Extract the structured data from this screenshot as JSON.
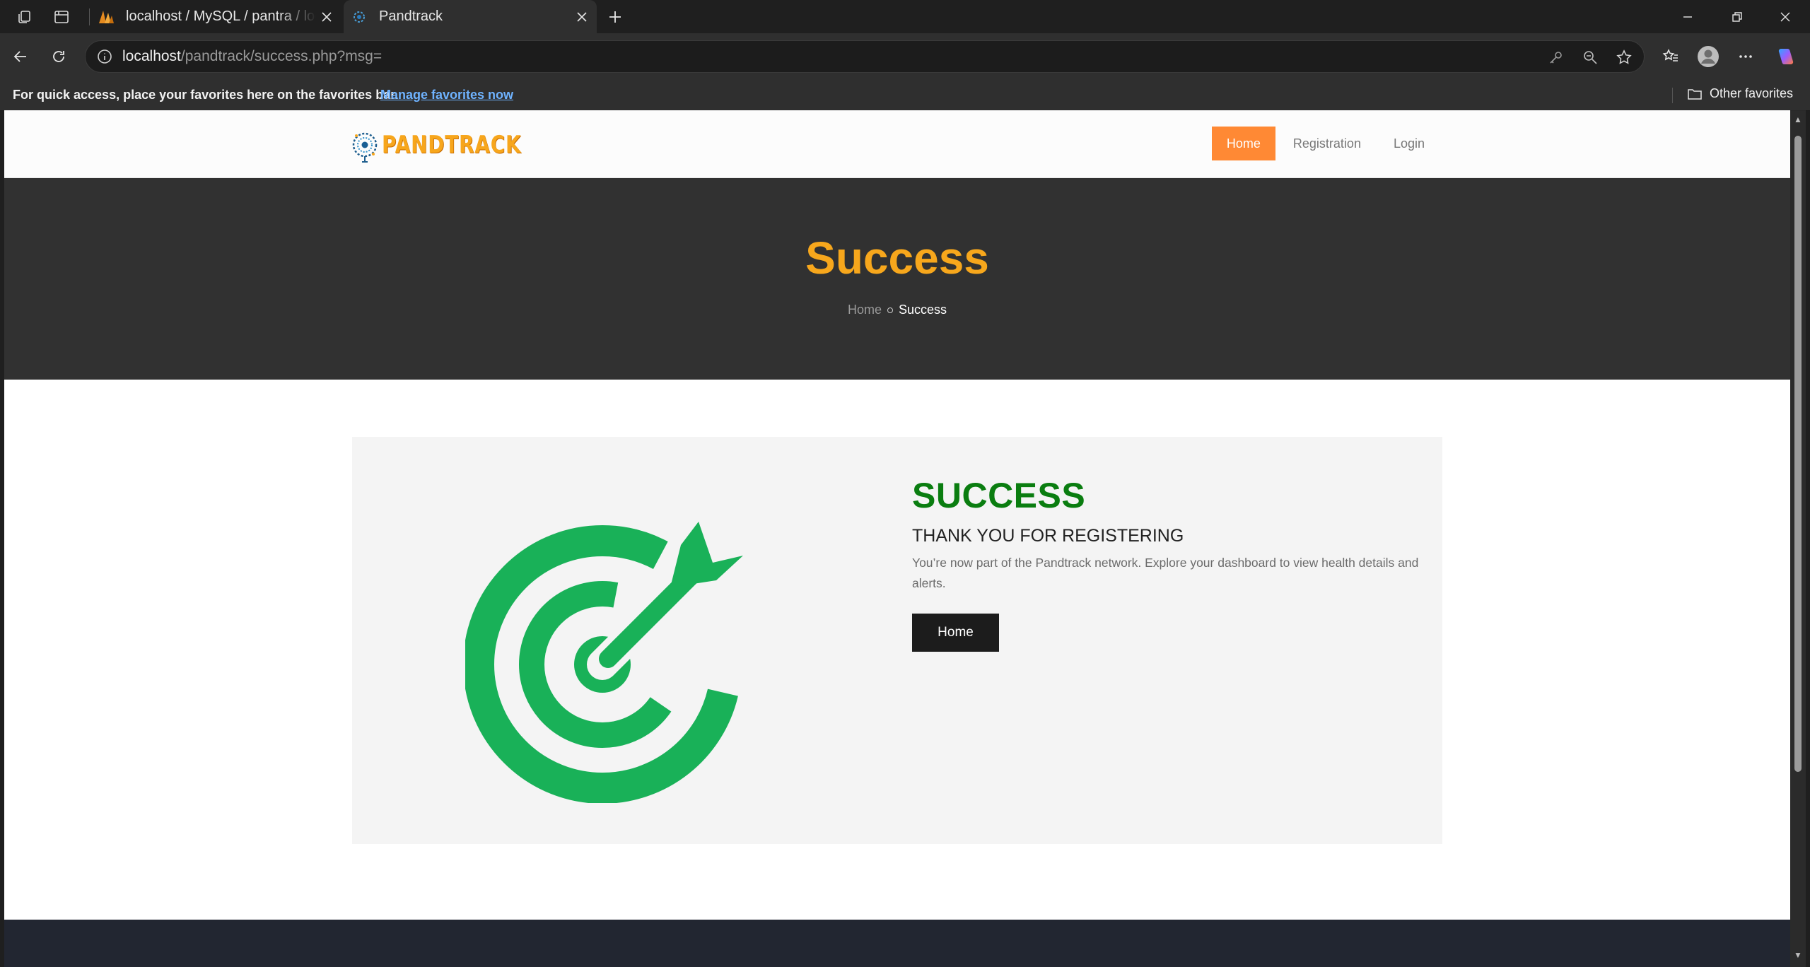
{
  "browser": {
    "tabs": [
      {
        "title": "localhost / MySQL / pantra / login",
        "active": false
      },
      {
        "title": "Pandtrack",
        "active": true
      }
    ],
    "address": {
      "host": "localhost",
      "path": "/pandtrack/success.php?msg="
    },
    "favorites_bar": {
      "message": "For quick access, place your favorites here on the favorites bar.",
      "link": "Manage favorites now",
      "other": "Other favorites"
    }
  },
  "site": {
    "logo_text": "PANDTRACK",
    "nav": [
      "Home",
      "Registration",
      "Login"
    ],
    "active_nav": "Home"
  },
  "hero": {
    "title": "Success",
    "breadcrumb": {
      "home": "Home",
      "current": "Success"
    }
  },
  "card": {
    "heading": "SUCCESS",
    "subheading": "THANK YOU FOR REGISTERING",
    "body": "You’re now part of the Pandtrack network. Explore your dashboard to view health details and alerts.",
    "button": "Home"
  },
  "colors": {
    "accent_orange": "#ff8934",
    "hero_title": "#f7a71c",
    "success_green": "#0a7d10",
    "target_green": "#19b158",
    "hero_bg": "#313131",
    "footer_bg": "#222631"
  },
  "icons": [
    "workspaces-icon",
    "tab-actions-icon",
    "phpmyadmin-favicon",
    "pandtrack-favicon",
    "close-icon",
    "plus-icon",
    "minimize-icon",
    "restore-icon",
    "back-icon",
    "refresh-icon",
    "info-icon",
    "key-icon",
    "zoom-out-icon",
    "star-icon",
    "favorites-icon",
    "profile-icon",
    "more-icon",
    "copilot-icon",
    "folder-icon",
    "target-icon"
  ]
}
